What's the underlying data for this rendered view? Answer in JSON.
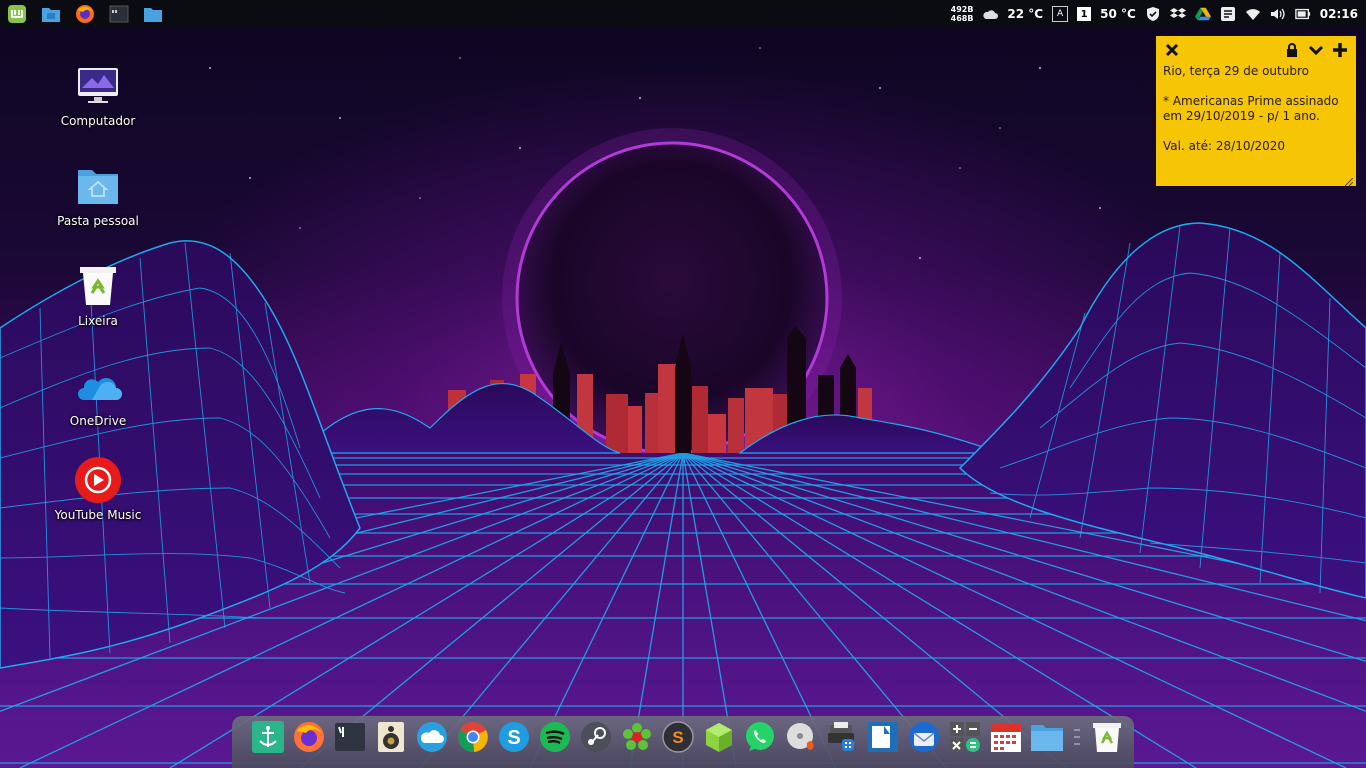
{
  "panel": {
    "launchers": [
      "mint-menu-icon",
      "files-icon",
      "firefox-icon",
      "terminal-icon",
      "folder-icon"
    ],
    "net_down": "492B",
    "net_up": "468B",
    "weather_temp": "22 °C",
    "keyboard_layout": "A",
    "workspace": "1",
    "cpu_temp": "50 °C",
    "clock": "02:16"
  },
  "desktop": {
    "icons": [
      {
        "label": "Computador",
        "icon": "computer-icon"
      },
      {
        "label": "Pasta pessoal",
        "icon": "home-folder-icon"
      },
      {
        "label": "Lixeira",
        "icon": "trash-icon"
      },
      {
        "label": "OneDrive",
        "icon": "onedrive-icon"
      },
      {
        "label": "YouTube Music",
        "icon": "youtube-music-icon"
      }
    ]
  },
  "note": {
    "line1": "Rio, terça 29 de outubro",
    "line2": "* Americanas Prime assinado",
    "line3": "em 29/10/2019 - p/ 1 ano.",
    "line4": "Val. até: 28/10/2020"
  },
  "dock": {
    "items": [
      "anchor-icon",
      "firefox-icon",
      "terminal-icon",
      "speaker-icon",
      "cloud-icon",
      "chrome-icon",
      "skype-icon",
      "spotify-icon",
      "steam-icon",
      "flower-icon",
      "s-app-icon",
      "cube-icon",
      "whatsapp-icon",
      "disc-burner-icon",
      "printer-icon",
      "panel-icon",
      "thunderbird-icon",
      "calculator-icon",
      "calendar-icon",
      "folder-icon",
      "separator-icon",
      "trash-icon"
    ]
  },
  "colors": {
    "panel_bg": "#0b0b12",
    "note_bg": "#f6c506",
    "grid_cyan": "#19a7e8",
    "sky_purple": "#3a0b5a"
  }
}
